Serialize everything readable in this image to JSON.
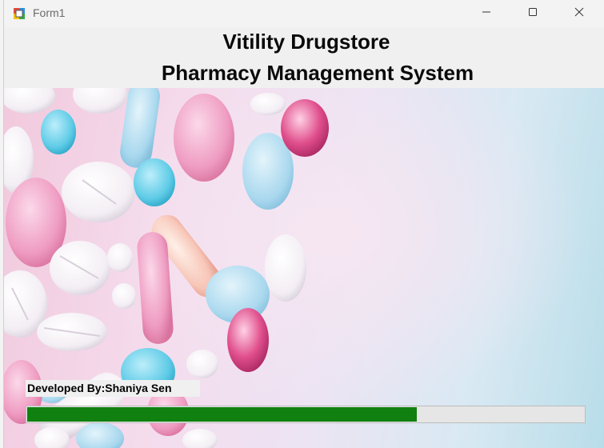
{
  "window": {
    "title": "Form1",
    "app_icon": "winforms-app-icon",
    "controls": {
      "minimize_icon": "minimize-icon",
      "maximize_icon": "maximize-icon",
      "close_icon": "close-icon"
    }
  },
  "header": {
    "title": "Vitility Drugstore",
    "subtitle": "Pharmacy Management System"
  },
  "hero": {
    "image": "pharmacy-pills-background"
  },
  "footer": {
    "developer_text": "Developed By:Shaniya Sen"
  },
  "progress": {
    "value_percent": 70,
    "color": "#108010",
    "track_color": "#e6e6e6"
  },
  "colors": {
    "title_text": "#0a0a0a",
    "form_background": "#f0f0f0"
  }
}
